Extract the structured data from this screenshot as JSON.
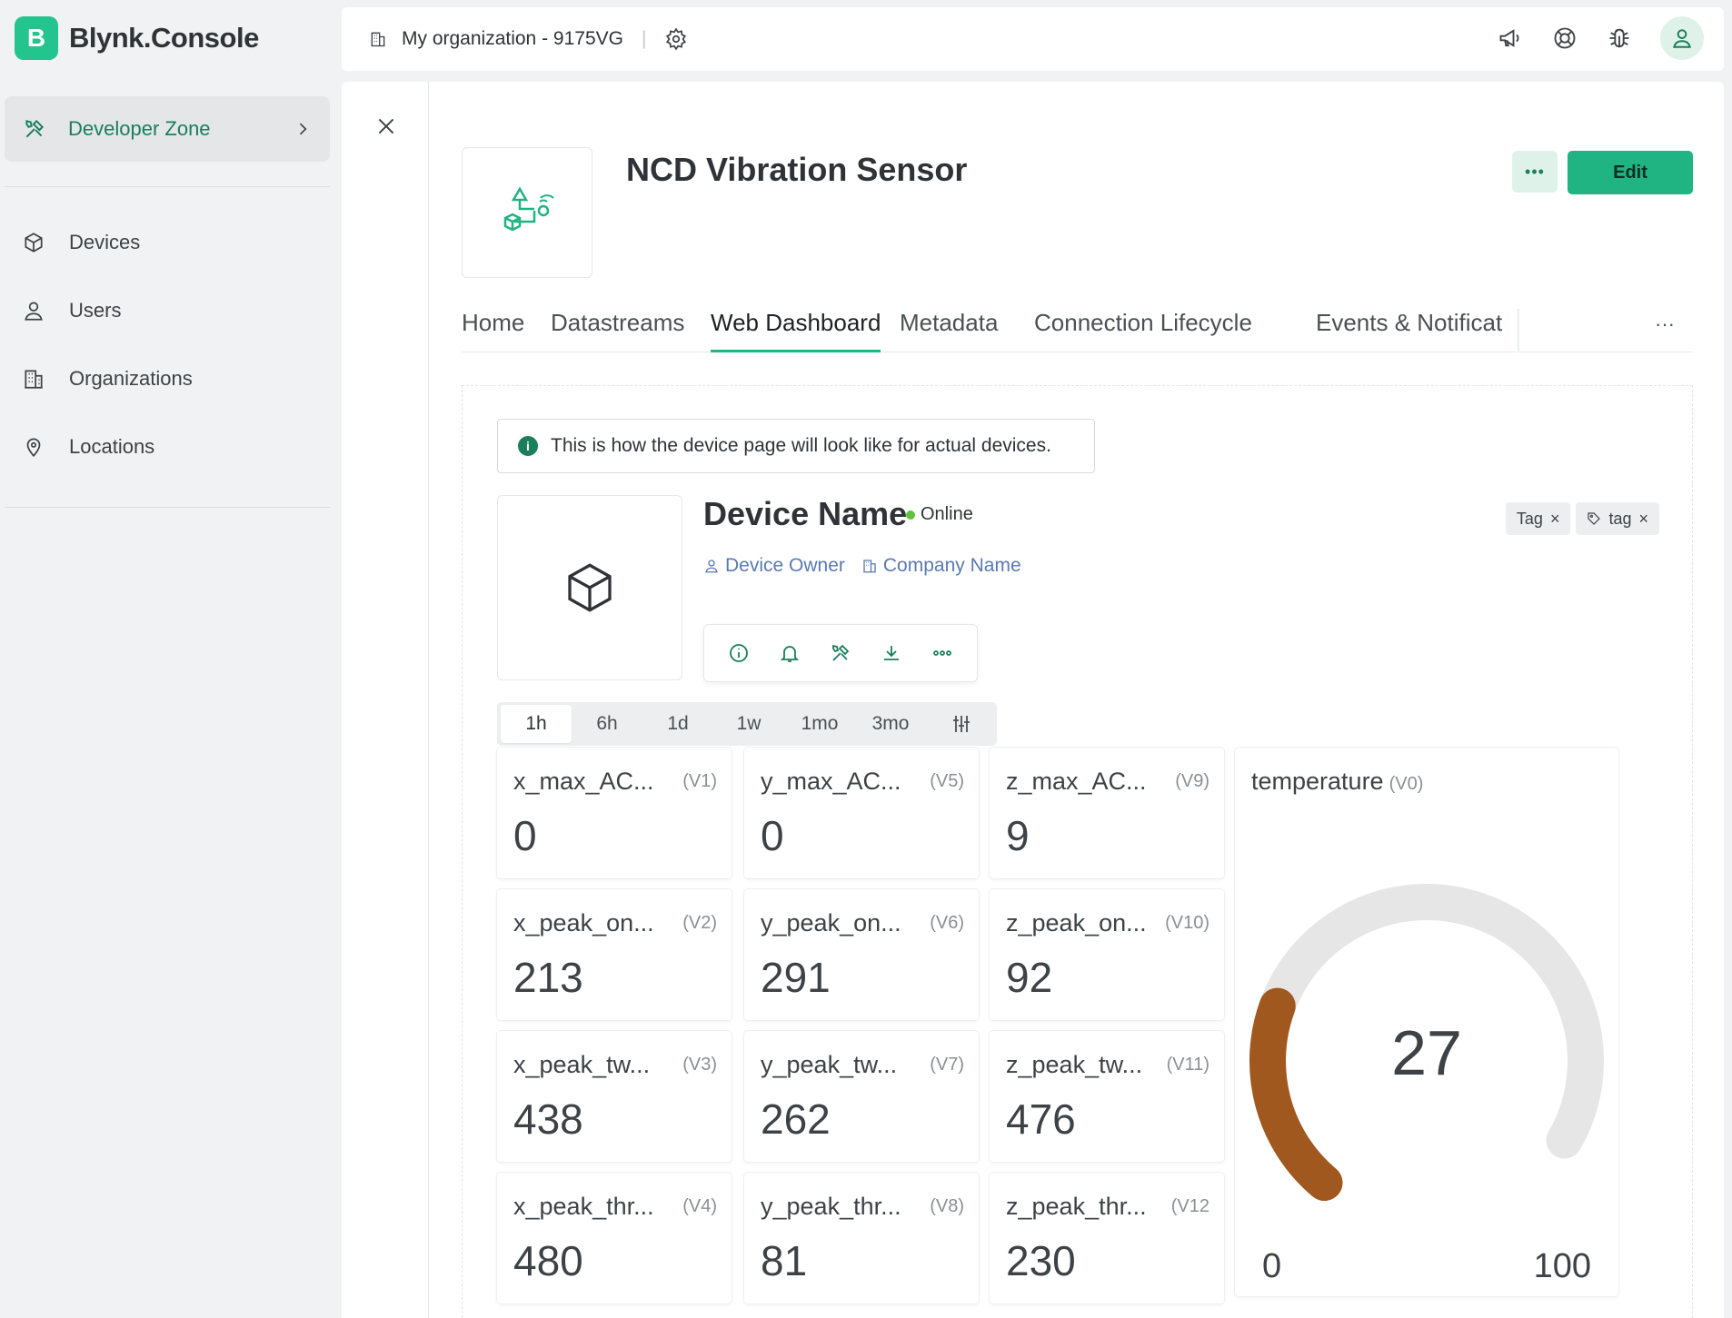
{
  "app": {
    "logo_letter": "B",
    "logo_text": "Blynk.Console"
  },
  "sidebar": {
    "developer_zone": "Developer Zone",
    "items": [
      {
        "label": "Devices",
        "icon": "cube-icon"
      },
      {
        "label": "Users",
        "icon": "users-icon"
      },
      {
        "label": "Organizations",
        "icon": "building-icon"
      },
      {
        "label": "Locations",
        "icon": "location-pin-icon"
      }
    ]
  },
  "topbar": {
    "organization": "My organization - 9175VG",
    "icons": [
      "megaphone-icon",
      "help-lifebuoy-icon",
      "bug-icon",
      "user-avatar-icon"
    ]
  },
  "template": {
    "title": "NCD Vibration Sensor",
    "more_label": "•••",
    "edit_label": "Edit"
  },
  "tabs": {
    "items": [
      "Home",
      "Datastreams",
      "Web Dashboard",
      "Metadata",
      "Connection Lifecycle",
      "Events & Notificat"
    ],
    "active": "Web Dashboard",
    "more_label": "···"
  },
  "dashboard": {
    "notice": "This is how the device page will look like for actual devices.",
    "device_name": "Device Name",
    "status": "Online",
    "owner": "Device Owner",
    "company": "Company Name",
    "tags": [
      "Tag",
      "tag"
    ],
    "time_ranges": [
      "1h",
      "6h",
      "1d",
      "1w",
      "1mo",
      "3mo"
    ],
    "selected_range": "1h",
    "tiles": [
      {
        "name": "x_max_AC...",
        "pin": "(V1)",
        "value": "0"
      },
      {
        "name": "y_max_AC...",
        "pin": "(V5)",
        "value": "0"
      },
      {
        "name": "z_max_AC...",
        "pin": "(V9)",
        "value": "9"
      },
      {
        "name": "x_peak_on...",
        "pin": "(V2)",
        "value": "213"
      },
      {
        "name": "y_peak_on...",
        "pin": "(V6)",
        "value": "291"
      },
      {
        "name": "z_peak_on...",
        "pin": "(V10)",
        "value": "92"
      },
      {
        "name": "x_peak_tw...",
        "pin": "(V3)",
        "value": "438"
      },
      {
        "name": "y_peak_tw...",
        "pin": "(V7)",
        "value": "262"
      },
      {
        "name": "z_peak_tw...",
        "pin": "(V11)",
        "value": "476"
      },
      {
        "name": "x_peak_thr...",
        "pin": "(V4)",
        "value": "480"
      },
      {
        "name": "y_peak_thr...",
        "pin": "(V8)",
        "value": "81"
      },
      {
        "name": "z_peak_thr...",
        "pin": "(V12",
        "value": "230"
      }
    ],
    "gauge": {
      "name": "temperature",
      "pin": "(V0)",
      "value": 27,
      "min": "0",
      "max": "100",
      "fill_color": "#a0581e",
      "track_color": "#e6e6e6"
    }
  },
  "colors": {
    "accent": "#1fb482",
    "accent_dark": "#1a7f5a",
    "link": "#5a7ab0"
  }
}
